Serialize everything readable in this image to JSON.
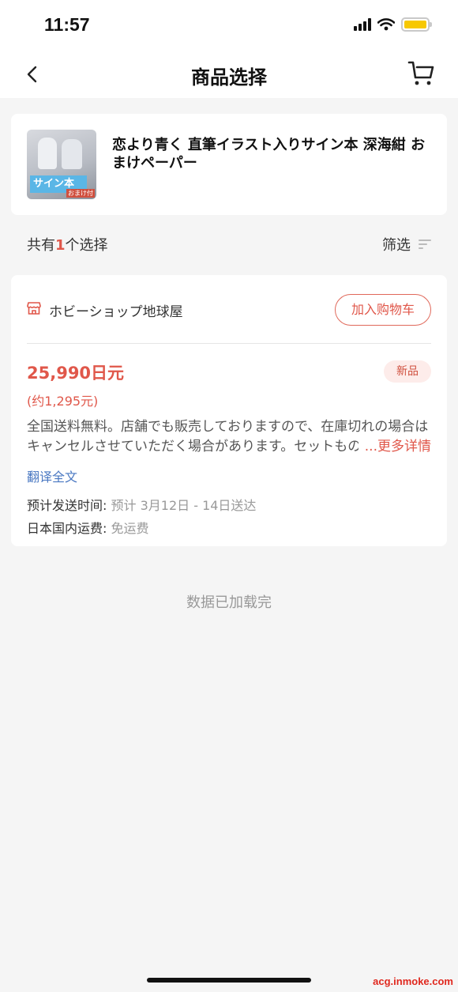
{
  "status_bar": {
    "time": "11:57"
  },
  "nav": {
    "title": "商品选择",
    "back_icon": "chevron-left-icon",
    "cart_icon": "cart-icon"
  },
  "product": {
    "title": "恋より青く 直筆イラスト入りサイン本 深海紺 おまけペーパー",
    "thumb_label": "サイン本",
    "thumb_sub_label": "おまけ付"
  },
  "count_row": {
    "prefix": "共有",
    "count": "1",
    "suffix": "个选择",
    "filter_label": "筛选",
    "filter_icon": "filter-icon"
  },
  "offer": {
    "shop_icon": "shop-icon",
    "shop_name": "ホビーショップ地球屋",
    "add_to_cart_label": "加入购物车",
    "price": "25,990日元",
    "condition": "新品",
    "price_approx": "(约1,295元)",
    "description_line1": "全国送料無料。店舗でも販売しておりますので、在庫切れの場合は",
    "description_line2": "キャンセルさせていただく場合があります。セットもの",
    "more_label": "...更多详情",
    "translate_label": "翻译全文",
    "shipping_time_label": "预计发送时间:",
    "shipping_time_value": "预计 3月12日 - 14日送达",
    "domestic_fee_label": "日本国内运费:",
    "domestic_fee_value": "免运费"
  },
  "end_text": "数据已加载完",
  "watermark": "acg.inmoke.com",
  "colors": {
    "accent": "#e0574a",
    "link": "#4a78c2",
    "background": "#f5f5f5"
  }
}
